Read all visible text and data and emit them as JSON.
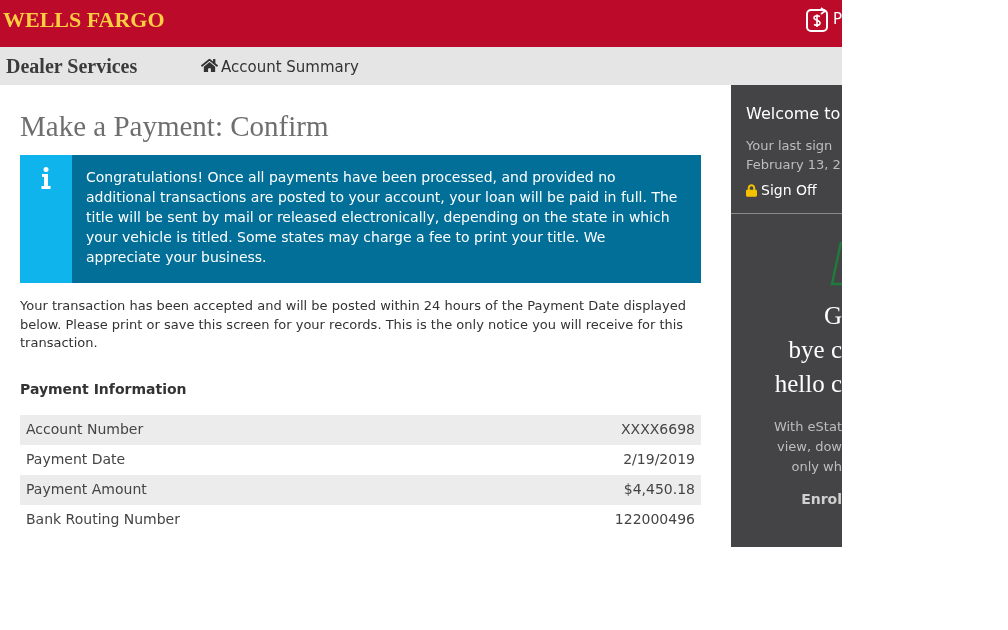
{
  "header": {
    "logo": "WELLS FARGO",
    "action_label": "P"
  },
  "nav": {
    "title": "Dealer Services",
    "links": [
      {
        "label": "Account Summary"
      }
    ]
  },
  "page": {
    "title": "Make a Payment: Confirm",
    "alert": {
      "text": "Congratulations! Once all payments have been processed, and provided no additional transactions are posted to your account, your loan will be paid in full. The title will be sent by mail or released electronically, depending on the state in which your vehicle is titled. Some states may charge a fee to print your title. We appreciate your business."
    },
    "intro": "Your transaction has been accepted and will be posted within 24 hours of the Payment Date displayed below. Please print or save this screen for your records. This is the only notice you will receive for this transaction.",
    "section_title": "Payment Information",
    "rows": [
      {
        "label": "Account Number",
        "value": "XXXX6698"
      },
      {
        "label": "Payment Date",
        "value": "2/19/2019"
      },
      {
        "label": "Payment Amount",
        "value": "$4,450.18"
      },
      {
        "label": "Bank Routing Number",
        "value": "122000496"
      }
    ]
  },
  "sidebar": {
    "welcome": "Welcome to",
    "last_sign_in": [
      "Your last sign",
      "February 13, 2"
    ],
    "sign_off": "Sign Off",
    "promo": {
      "headline": [
        "G",
        "bye c",
        "hello c"
      ],
      "body": [
        "With eStat",
        "view, dow",
        "only wh"
      ],
      "cta": "Enrol"
    }
  }
}
